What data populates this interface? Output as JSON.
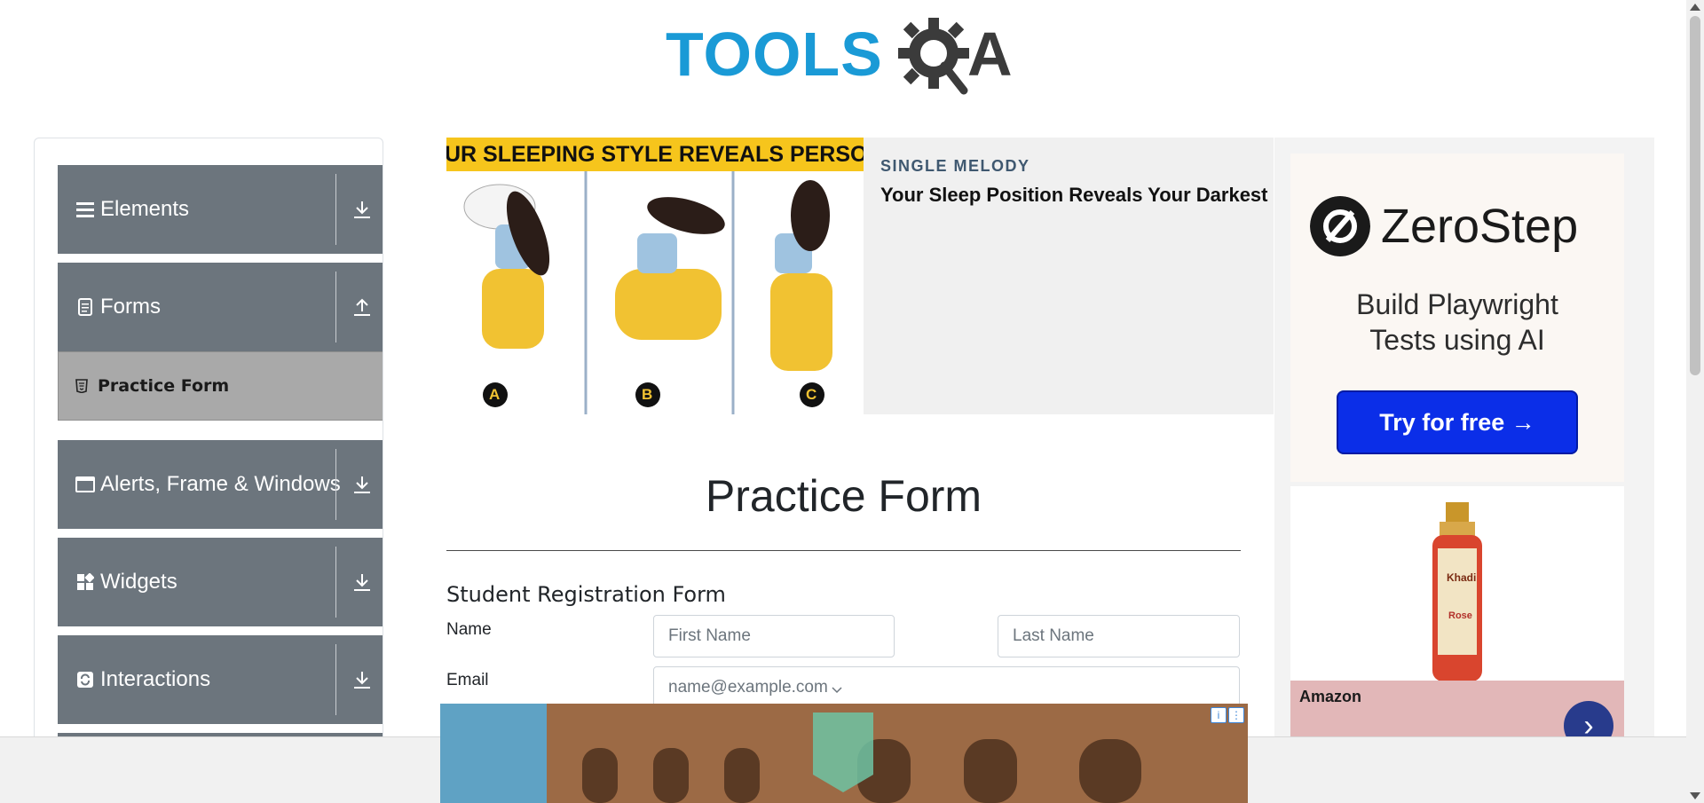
{
  "header": {
    "logo_text": "TOOLSQA",
    "logo_left": "TOOLS",
    "logo_right": "A"
  },
  "sidebar": {
    "groups": [
      {
        "label": "Elements",
        "icon": "hamburger-icon",
        "toggle_icon": "expand-icon"
      },
      {
        "label": "Forms",
        "icon": "document-icon",
        "toggle_icon": "collapse-icon",
        "items": [
          {
            "label": "Practice Form",
            "icon": "html5-icon"
          }
        ]
      },
      {
        "label": "Alerts, Frame & Windows",
        "icon": "window-icon",
        "toggle_icon": "expand-icon"
      },
      {
        "label": "Widgets",
        "icon": "widgets-icon",
        "toggle_icon": "expand-icon"
      },
      {
        "label": "Interactions",
        "icon": "refresh-icon",
        "toggle_icon": "expand-icon"
      }
    ]
  },
  "top_ad": {
    "banner": "UR SLEEPING STYLE REVEALS PERSONALI",
    "source": "SINGLE MELODY",
    "headline": "Your Sleep Position Reveals Your Darkest",
    "markers": [
      "A",
      "B",
      "C"
    ]
  },
  "right_ad": {
    "brand": "ZeroStep",
    "tagline_line1": "Build Playwright",
    "tagline_line2": "Tests using AI",
    "cta": "Try for free →",
    "product_label": "Khadi",
    "product_sub": "Rose",
    "advertiser": "Amazon"
  },
  "main": {
    "page_title": "Practice Form",
    "form_title": "Student Registration Form",
    "fields": {
      "name_label": "Name",
      "first_name_placeholder": "First Name",
      "last_name_placeholder": "Last Name",
      "email_label": "Email",
      "email_placeholder": "name@example.com"
    }
  },
  "colors": {
    "sidebar_group": "#6c757d",
    "sidebar_active": "#a9a9a9",
    "logo_blue": "#1a9ad6",
    "cta_blue": "#0b2ee8",
    "ad_banner_yellow": "#f6c51c"
  }
}
